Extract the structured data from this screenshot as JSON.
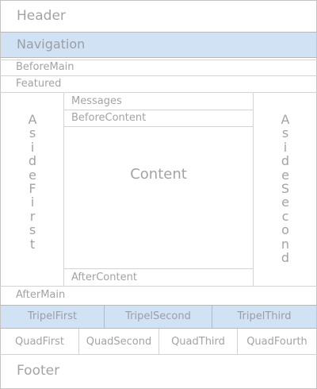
{
  "header": {
    "label": "Header"
  },
  "navigation": {
    "label": "Navigation"
  },
  "before_main": {
    "label": "BeforeMain"
  },
  "featured": {
    "label": "Featured"
  },
  "aside_first": {
    "label": "AsideFirst"
  },
  "aside_second": {
    "label": "AsideSecond"
  },
  "messages": {
    "label": "Messages"
  },
  "before_content": {
    "label": "BeforeContent"
  },
  "content": {
    "label": "Content"
  },
  "after_content": {
    "label": "AfterContent"
  },
  "after_main": {
    "label": "AfterMain"
  },
  "tripel": [
    "TripelFirst",
    "TripelSecond",
    "TripelThird"
  ],
  "quad": [
    "QuadFirst",
    "QuadSecond",
    "QuadThird",
    "QuadFourth"
  ],
  "footer": {
    "label": "Footer"
  },
  "colors": {
    "highlight": "#d1e2f4",
    "text": "#a3a3a3",
    "border": "#c4c4c4"
  }
}
